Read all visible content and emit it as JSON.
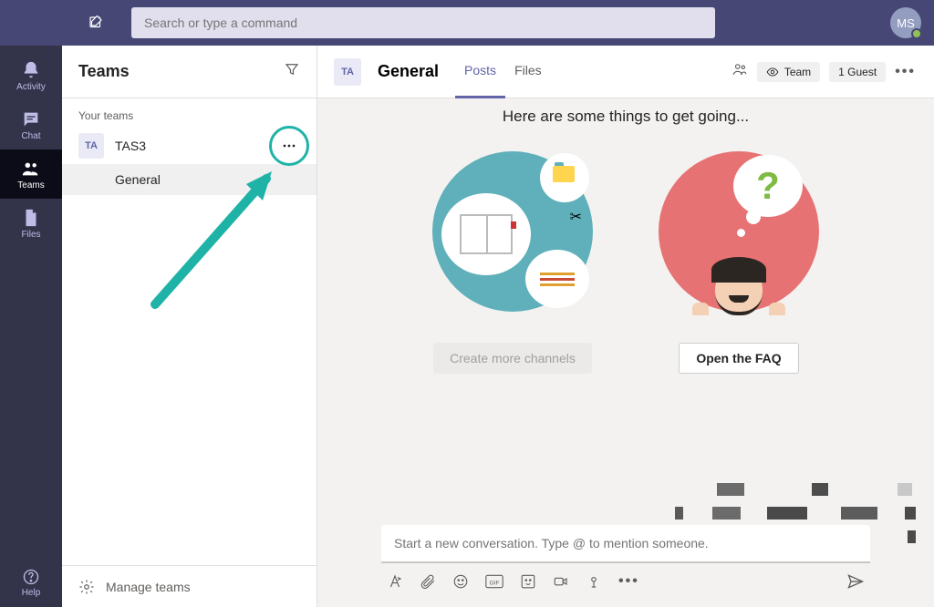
{
  "topbar": {
    "search_placeholder": "Search or type a command",
    "avatar_initials": "MS"
  },
  "rail": {
    "items": [
      {
        "label": "Activity"
      },
      {
        "label": "Chat"
      },
      {
        "label": "Teams"
      },
      {
        "label": "Files"
      }
    ],
    "help_label": "Help"
  },
  "sidebar": {
    "title": "Teams",
    "section_label": "Your teams",
    "team": {
      "avatar": "TA",
      "name": "TAS3"
    },
    "channel": "General",
    "manage_label": "Manage teams"
  },
  "channel_header": {
    "avatar": "TA",
    "title": "General",
    "tabs": [
      "Posts",
      "Files"
    ],
    "privacy_label": "Team",
    "guest_label": "1 Guest"
  },
  "content": {
    "heading": "Here are some things to get going...",
    "card_channels_btn": "Create more channels",
    "card_faq_btn": "Open the FAQ"
  },
  "compose": {
    "placeholder": "Start a new conversation. Type @ to mention someone."
  },
  "colors": {
    "purple": "#464775",
    "teal_accent": "#1fb3a7",
    "pink": "#e77273"
  }
}
